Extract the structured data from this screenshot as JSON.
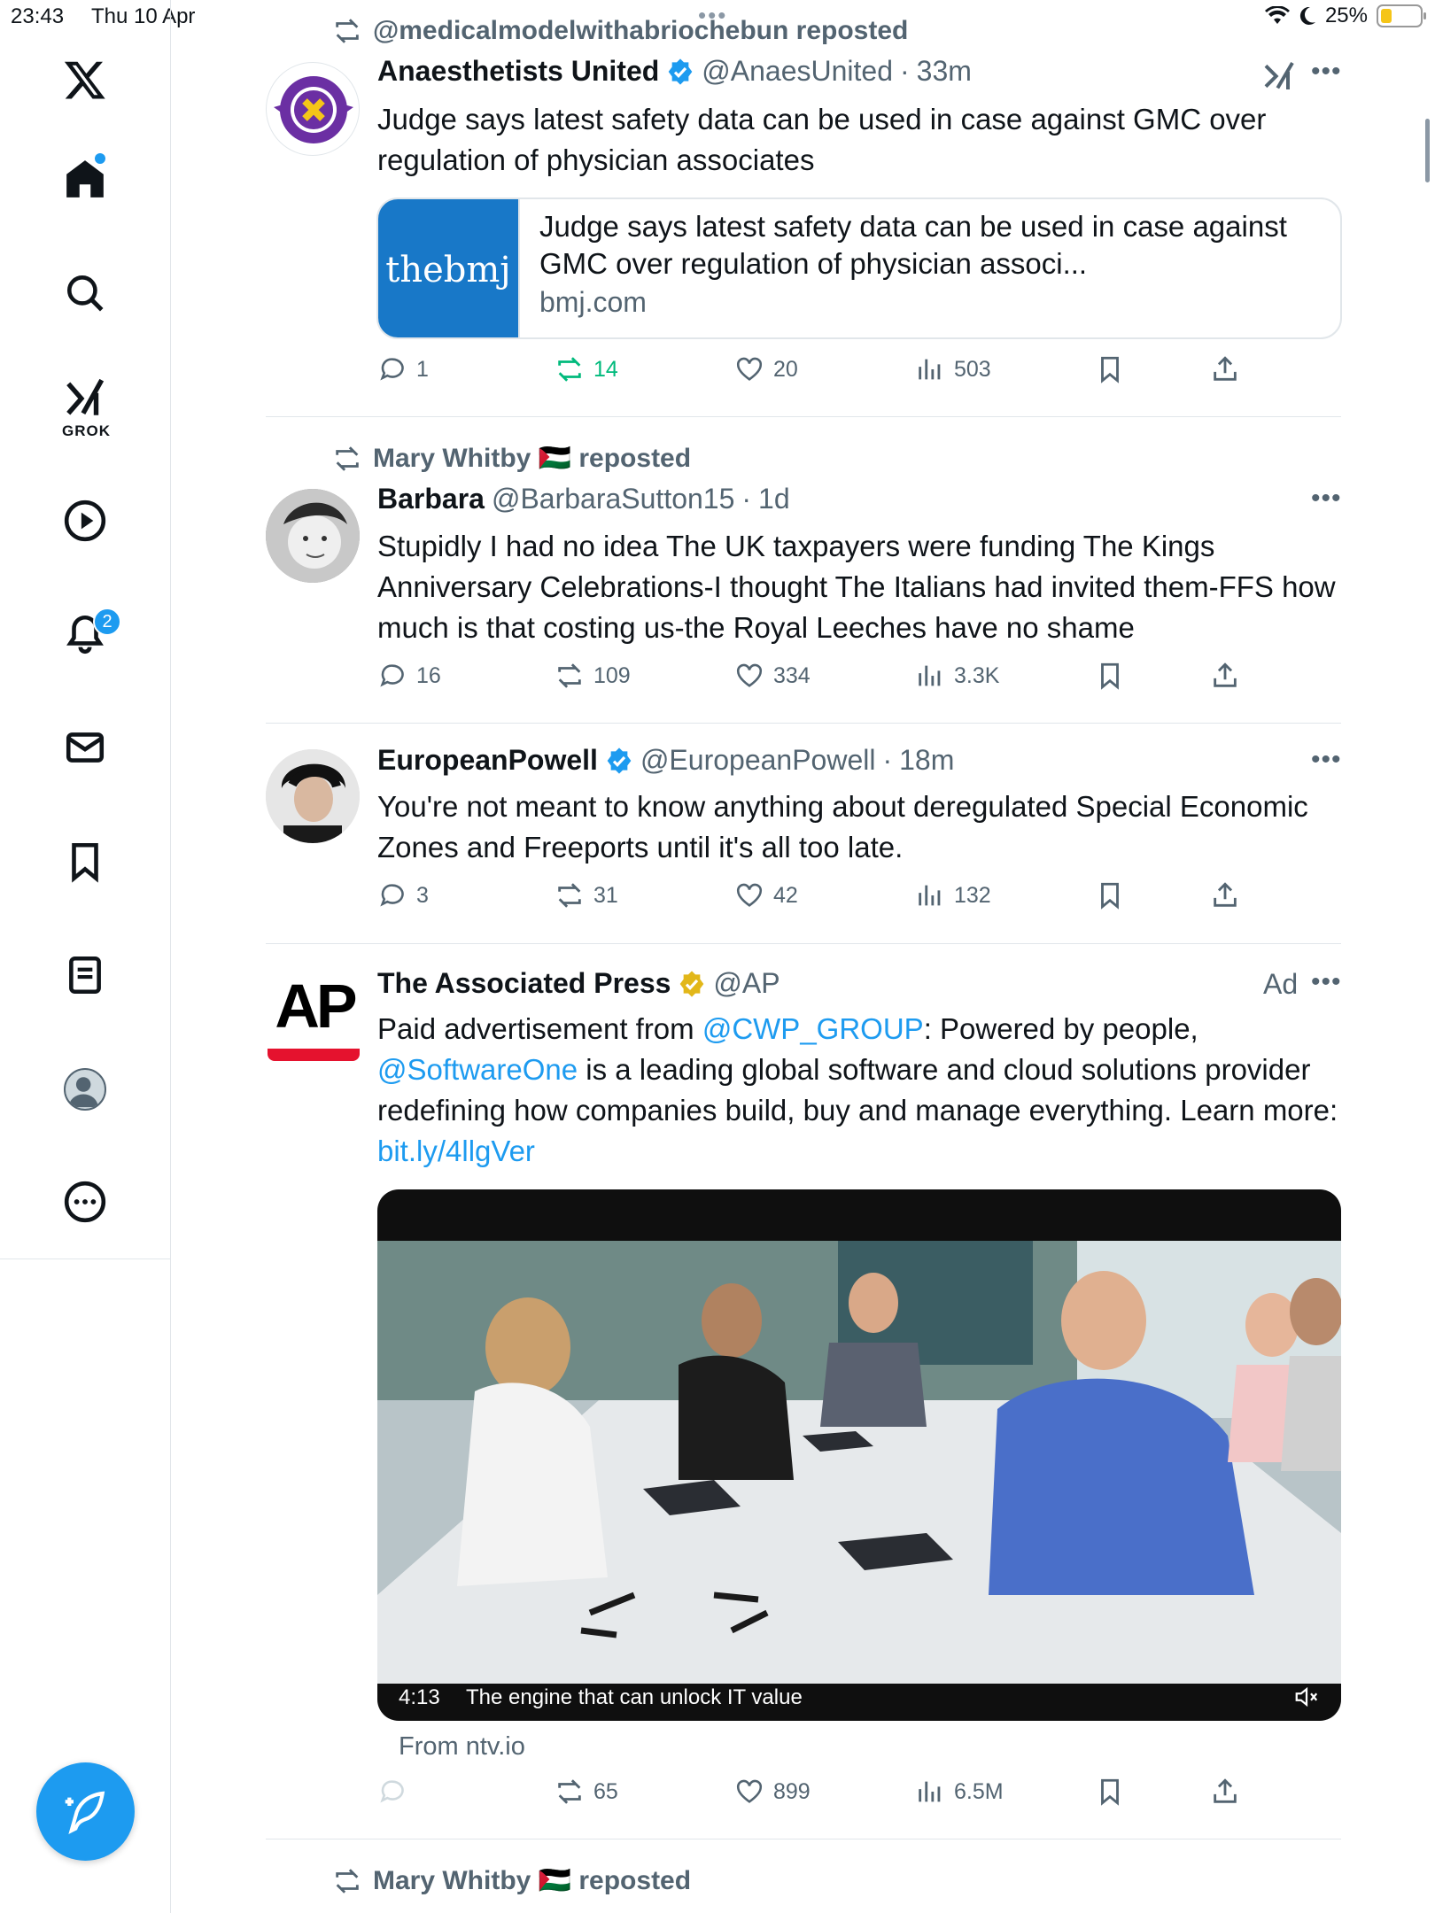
{
  "status_bar": {
    "time": "23:43",
    "date": "Thu 10 Apr",
    "battery": "25%",
    "battery_level": 0.25
  },
  "sidebar": {
    "items": [
      "X logo",
      "Home",
      "Search",
      "Grok",
      "Video",
      "Notifications",
      "Messages",
      "Bookmarks",
      "Lists",
      "Profile",
      "More"
    ],
    "grok_label": "GROK",
    "notifications_badge": "2",
    "compose_label": "Post"
  },
  "posts": [
    {
      "repost_by": "@medicalmodelwithabriochebun reposted",
      "name": "Anaesthetists United",
      "handle": "@AnaesUnited",
      "time": "33m",
      "text": "Judge says latest safety data can be used in case against GMC over regulation of physician associates",
      "card": {
        "logo": "thebmj",
        "title": "Judge says latest safety data can be used in case against GMC over regulation of physician associ...",
        "domain": "bmj.com"
      },
      "stats": {
        "replies": "1",
        "reposts": "14",
        "likes": "20",
        "views": "503"
      }
    },
    {
      "repost_by": "Mary Whitby 🇵🇸 reposted",
      "name": "Barbara",
      "handle": "@BarbaraSutton15",
      "time": "1d",
      "text": "Stupidly I had no idea The UK taxpayers were funding The Kings Anniversary Celebrations-I thought The Italians had invited them-FFS how much is that costing us-the Royal Leeches have no shame",
      "stats": {
        "replies": "16",
        "reposts": "109",
        "likes": "334",
        "views": "3.3K"
      }
    },
    {
      "name": "EuropeanPowell",
      "handle": "@EuropeanPowell",
      "time": "18m",
      "text": "You're not meant to know anything about deregulated Special Economic Zones and Freeports until it's all too late.",
      "stats": {
        "replies": "3",
        "reposts": "31",
        "likes": "42",
        "views": "132"
      }
    },
    {
      "name": "The Associated Press",
      "handle": "@AP",
      "ad_label": "Ad",
      "avatar_text": "AP",
      "text_parts": {
        "p1": "Paid advertisement from ",
        "m1": "@CWP_GROUP",
        "p2": ": Powered by people, ",
        "m2": "@SoftwareOne",
        "p3": " is a leading global software and cloud solutions provider redefining how companies build, buy and manage everything. Learn more: ",
        "l1": "bit.ly/4llgVer"
      },
      "video": {
        "duration": "4:13",
        "caption": "The engine that can unlock IT value",
        "source": "From ntv.io"
      },
      "stats": {
        "replies": "",
        "reposts": "65",
        "likes": "899",
        "views": "6.5M"
      }
    },
    {
      "repost_by": "Mary Whitby 🇵🇸 reposted"
    }
  ],
  "colors": {
    "accent": "#1d9bf0",
    "repost_green": "#00ba7c",
    "verified_gold": "#e2b719",
    "text": "#0f1419",
    "muted": "#536471"
  }
}
